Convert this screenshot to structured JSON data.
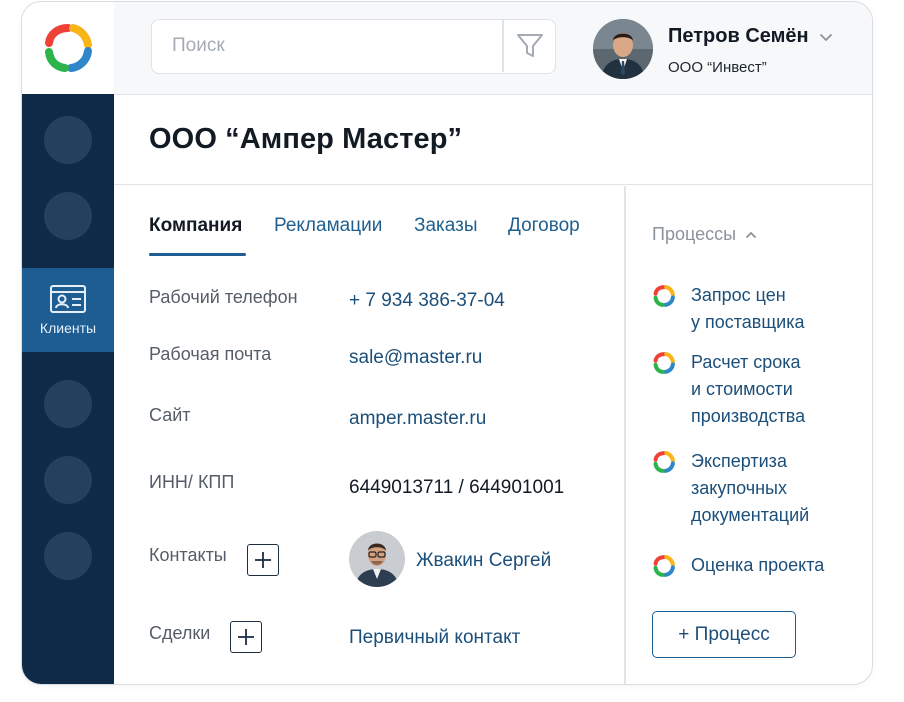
{
  "search": {
    "placeholder": "Поиск"
  },
  "user": {
    "name": "Петров Семён",
    "org": "ООО “Инвест”"
  },
  "sidebar": {
    "active_label": "Клиенты"
  },
  "company": {
    "title": "ООО “Ампер Мастер”"
  },
  "tabs": [
    {
      "label": "Компания"
    },
    {
      "label": "Рекламации"
    },
    {
      "label": "Заказы"
    },
    {
      "label": "Договор"
    }
  ],
  "fields": {
    "phone": {
      "label": "Рабочий телефон",
      "value": "+ 7 934 386-37-04"
    },
    "email": {
      "label": "Рабочая почта",
      "value": "sale@master.ru"
    },
    "site": {
      "label": "Сайт",
      "value": "amper.master.ru"
    },
    "inn": {
      "label": "ИНН/ КПП",
      "value": "6449013711 /  644901001"
    },
    "contacts": {
      "label": "Контакты",
      "value": "Жвакин Сергей"
    },
    "deals": {
      "label": "Сделки",
      "value": "Первичный контакт"
    }
  },
  "processes": {
    "header": "Процессы",
    "items": [
      {
        "line1": "Запрос цен",
        "line2": "у поставщика",
        "line3": ""
      },
      {
        "line1": "Расчет срока",
        "line2": "и стоимости",
        "line3": "производства"
      },
      {
        "line1": "Экспертиза",
        "line2": "закупочных",
        "line3": "документаций"
      },
      {
        "line1": "Оценка проекта",
        "line2": "",
        "line3": ""
      }
    ],
    "add_label": "+ Процесс"
  },
  "colors": {
    "sidebar_bg": "#0e2a47",
    "sidebar_active": "#1e5d91",
    "link": "#1b4f7a",
    "logo_red": "#ef4136",
    "logo_yellow": "#f9b417",
    "logo_green": "#2cb34a",
    "logo_blue": "#2f86c8"
  }
}
